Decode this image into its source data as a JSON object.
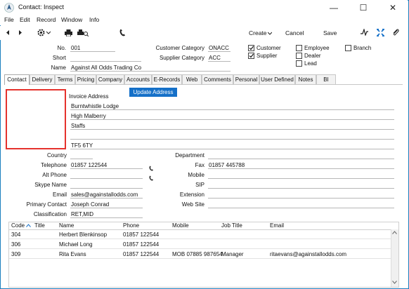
{
  "window": {
    "title": "Contact: Inspect",
    "min": "—",
    "max": "☐",
    "close": "✕"
  },
  "menu": [
    "File",
    "Edit",
    "Record",
    "Window",
    "Info"
  ],
  "toolbar": {
    "create": "Create",
    "cancel": "Cancel",
    "save": "Save"
  },
  "header": {
    "no_label": "No.",
    "no_value": "001",
    "short_label": "Short",
    "short_value": "",
    "name_label": "Name",
    "name_value": "Against All Odds Trading Co",
    "custcat_label": "Customer Category",
    "custcat_value": "ONACC",
    "suppcat_label": "Supplier Category",
    "suppcat_value": "ACC",
    "checks": {
      "customer": "Customer",
      "supplier": "Supplier",
      "employee": "Employee",
      "dealer": "Dealer",
      "lead": "Lead",
      "branch": "Branch"
    }
  },
  "tabs": [
    "Contact",
    "Delivery",
    "Terms",
    "Pricing",
    "Company",
    "Accounts",
    "E-Records",
    "Web",
    "Comments",
    "Personal",
    "User Defined",
    "Notes",
    "BI"
  ],
  "contact": {
    "invoice_address_label": "Invoice Address",
    "update_address": "Update Address",
    "address": [
      "Burntwhistle Lodge",
      "High Malberry",
      "Staffs",
      "",
      "TF5 6TY"
    ],
    "country_label": "Country",
    "country_value": "",
    "telephone_label": "Telephone",
    "telephone_value": "01857 122544",
    "altphone_label": "Alt Phone",
    "altphone_value": "",
    "skype_label": "Skype Name",
    "skype_value": "",
    "email_label": "Email",
    "email_value": "sales@againstallodds.com",
    "primary_label": "Primary Contact",
    "primary_value": "Joseph Conrad",
    "class_label": "Classification",
    "class_value": "RET,MID",
    "department_label": "Department",
    "department_value": "",
    "fax_label": "Fax",
    "fax_value": "01857 445788",
    "mobile_label": "Mobile",
    "mobile_value": "",
    "sip_label": "SIP",
    "sip_value": "",
    "extension_label": "Extension",
    "extension_value": "",
    "website_label": "Web Site",
    "website_value": ""
  },
  "grid": {
    "columns": [
      "Code",
      "Title",
      "Name",
      "Phone",
      "Mobile",
      "Job Title",
      "Email"
    ],
    "rows": [
      [
        "304",
        "",
        "Herbert Blenkinsop",
        "01857 122544",
        "",
        "",
        ""
      ],
      [
        "306",
        "",
        "Michael Long",
        "01857 122544",
        "",
        "",
        ""
      ],
      [
        "309",
        "",
        "Rita Evans",
        "01857 122544",
        "MOB 07885 987654",
        "Manager",
        "ritaevans@againstallodds.com"
      ]
    ]
  }
}
